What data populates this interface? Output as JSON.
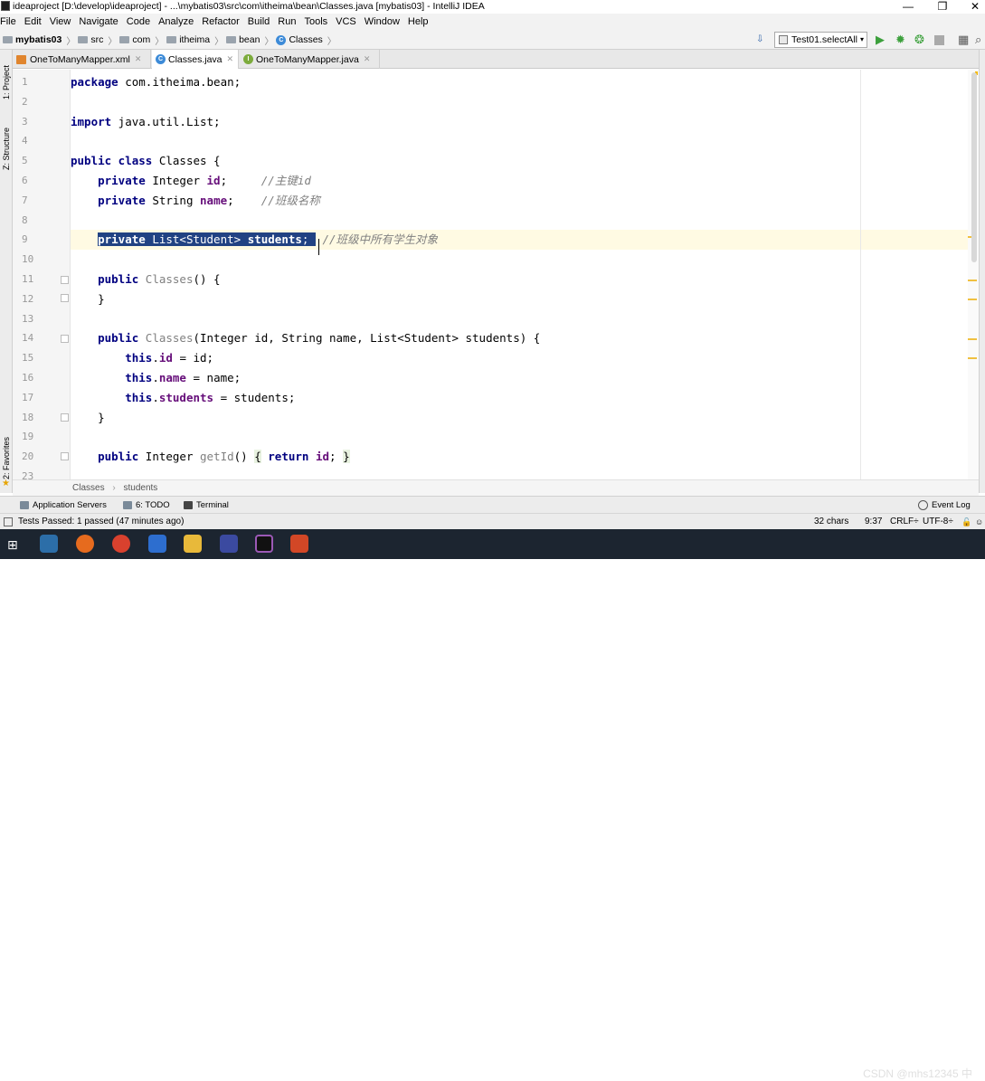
{
  "window": {
    "title": "ideaproject [D:\\develop\\ideaproject] - ...\\mybatis03\\src\\com\\itheima\\bean\\Classes.java [mybatis03] - IntelliJ IDEA",
    "minimize": "—",
    "maximize": "❐",
    "close": "✕"
  },
  "menu": [
    "File",
    "Edit",
    "View",
    "Navigate",
    "Code",
    "Analyze",
    "Refactor",
    "Build",
    "Run",
    "Tools",
    "VCS",
    "Window",
    "Help"
  ],
  "nav": {
    "crumbs": [
      "mybatis03",
      "src",
      "com",
      "itheima",
      "bean",
      "Classes"
    ],
    "run_config": "Test01.selectAll"
  },
  "tabs": [
    {
      "label": "OneToManyMapper.xml",
      "active": false
    },
    {
      "label": "Classes.java",
      "active": true
    },
    {
      "label": "OneToManyMapper.java",
      "active": false
    }
  ],
  "left_tools": [
    "1: Project",
    "Z: Structure",
    "2: Favorites"
  ],
  "code": {
    "line_numbers": [
      "1",
      "2",
      "3",
      "4",
      "5",
      "6",
      "7",
      "8",
      "9",
      "10",
      "11",
      "12",
      "13",
      "14",
      "15",
      "16",
      "17",
      "18",
      "19",
      "20",
      "23"
    ],
    "l1_kw": "package",
    "l1_rest": " com.itheima.bean;",
    "l3_kw": "import",
    "l3_rest": " java.util.List;",
    "l5_kw": "public class",
    "l5_rest": " Classes {",
    "l6_kw": "private",
    "l6_type": " Integer ",
    "l6_field": "id",
    "l6_semi": ";",
    "l6_comment": "//主键id",
    "l7_kw": "private",
    "l7_type": " String ",
    "l7_field": "name",
    "l7_semi": ";",
    "l7_comment": "//班级名称",
    "l9_kw": "private",
    "l9_type": " List<Student> ",
    "l9_field": "students",
    "l9_semi": ";",
    "l9_comment": "//班级中所有学生对象",
    "l11_kw": "public",
    "l11_name": " Classes",
    "l11_rest": "() {",
    "l12": "}",
    "l14_kw": "public",
    "l14_name": " Classes",
    "l14_rest": "(Integer id, String name, List<Student> students) {",
    "l15_this": "this",
    "l15_dot": ".",
    "l15_field": "id",
    "l15_rest": " = id;",
    "l16_this": "this",
    "l16_dot": ".",
    "l16_field": "name",
    "l16_rest": " = name;",
    "l17_this": "this",
    "l17_dot": ".",
    "l17_field": "students",
    "l17_rest": " = students;",
    "l18": "}",
    "l20_kw": "public",
    "l20_type": " Integer ",
    "l20_name": "getId",
    "l20_paren": "() ",
    "l20_open": "{",
    "l20_ret": " return ",
    "l20_field": "id",
    "l20_semi": "; ",
    "l20_close": "}"
  },
  "breadcrumbs": {
    "a": "Classes",
    "sep": "›",
    "b": "students"
  },
  "toolwindows": {
    "app_servers": "Application Servers",
    "todo": "6: TODO",
    "terminal": "Terminal",
    "event_log": "Event Log"
  },
  "status": {
    "tests": "Tests Passed: 1 passed (47 minutes ago)",
    "chars": "32 chars",
    "pos": "9:37",
    "crlf": "CRLF÷",
    "enc": "UTF-8÷"
  },
  "watermark": "CSDN @mhs12345 中"
}
